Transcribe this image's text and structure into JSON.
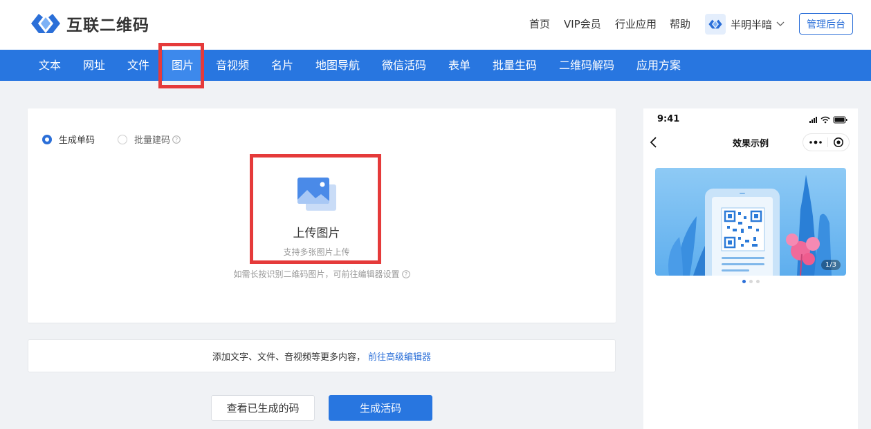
{
  "header": {
    "brand": "互联二维码",
    "nav": [
      "首页",
      "VIP会员",
      "行业应用",
      "帮助"
    ],
    "user_name": "半明半暗",
    "admin_button": "管理后台"
  },
  "tabs": [
    "文本",
    "网址",
    "文件",
    "图片",
    "音视频",
    "名片",
    "地图导航",
    "微信活码",
    "表单",
    "批量生码",
    "二维码解码",
    "应用方案"
  ],
  "active_tab": "图片",
  "form": {
    "mode_single": "生成单码",
    "mode_batch": "批量建码",
    "upload_title": "上传图片",
    "upload_subtitle": "支持多张图片上传",
    "hint": "如需长按识别二维码图片，可前往编辑器设置"
  },
  "advanced": {
    "text": "添加文字、文件、音视频等更多内容，",
    "link": "前往高级编辑器"
  },
  "buttons": {
    "view_generated": "查看已生成的码",
    "generate": "生成活码"
  },
  "preview": {
    "time": "9:41",
    "title": "效果示例",
    "page_indicator": "1/3"
  },
  "colors": {
    "primary": "#2876e0",
    "highlight": "#e53a3a"
  }
}
